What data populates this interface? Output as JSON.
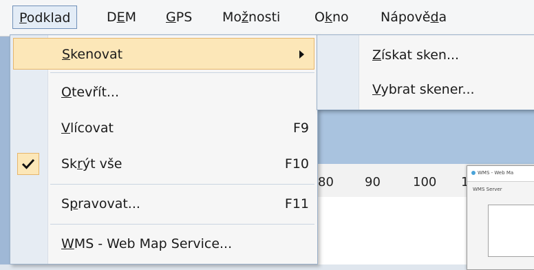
{
  "menubar": {
    "items": [
      {
        "pre": "",
        "u": "P",
        "post": "odklad"
      },
      {
        "pre": "D",
        "u": "E",
        "post": "M"
      },
      {
        "pre": "",
        "u": "G",
        "post": "PS"
      },
      {
        "pre": "Mo",
        "u": "ž",
        "post": "nosti"
      },
      {
        "pre": "O",
        "u": "k",
        "post": "no"
      },
      {
        "pre": "Nápově",
        "u": "d",
        "post": "a"
      }
    ]
  },
  "dropdown": {
    "items": [
      {
        "pre": "",
        "u": "S",
        "post": "kenovat",
        "shortcut": ""
      },
      {
        "pre": "",
        "u": "O",
        "post": "tevřít...",
        "shortcut": ""
      },
      {
        "pre": "",
        "u": "V",
        "post": "lícovat",
        "shortcut": "F9"
      },
      {
        "pre": "Sk",
        "u": "r",
        "post": "ýt vše",
        "shortcut": "F10"
      },
      {
        "pre": "S",
        "u": "p",
        "post": "ravovat...",
        "shortcut": "F11"
      },
      {
        "pre": "",
        "u": "W",
        "post": "MS - Web Map Service...",
        "shortcut": ""
      }
    ]
  },
  "submenu": {
    "items": [
      {
        "pre": "",
        "u": "Z",
        "post": "ískat sken..."
      },
      {
        "pre": "",
        "u": "V",
        "post": "ybrat skener..."
      }
    ]
  },
  "ruler": {
    "ticks": [
      "80",
      "90",
      "100",
      "1"
    ]
  },
  "wms_window": {
    "title": "WMS - Web Ma",
    "label": "WMS Server"
  },
  "colors": {
    "highlight": "#fce7b8",
    "highlight_border": "#e6b56a",
    "menu_active": "#e3ecf6"
  },
  "icons": {
    "check": "check-icon",
    "submenu_arrow": "chevron-right-icon"
  }
}
